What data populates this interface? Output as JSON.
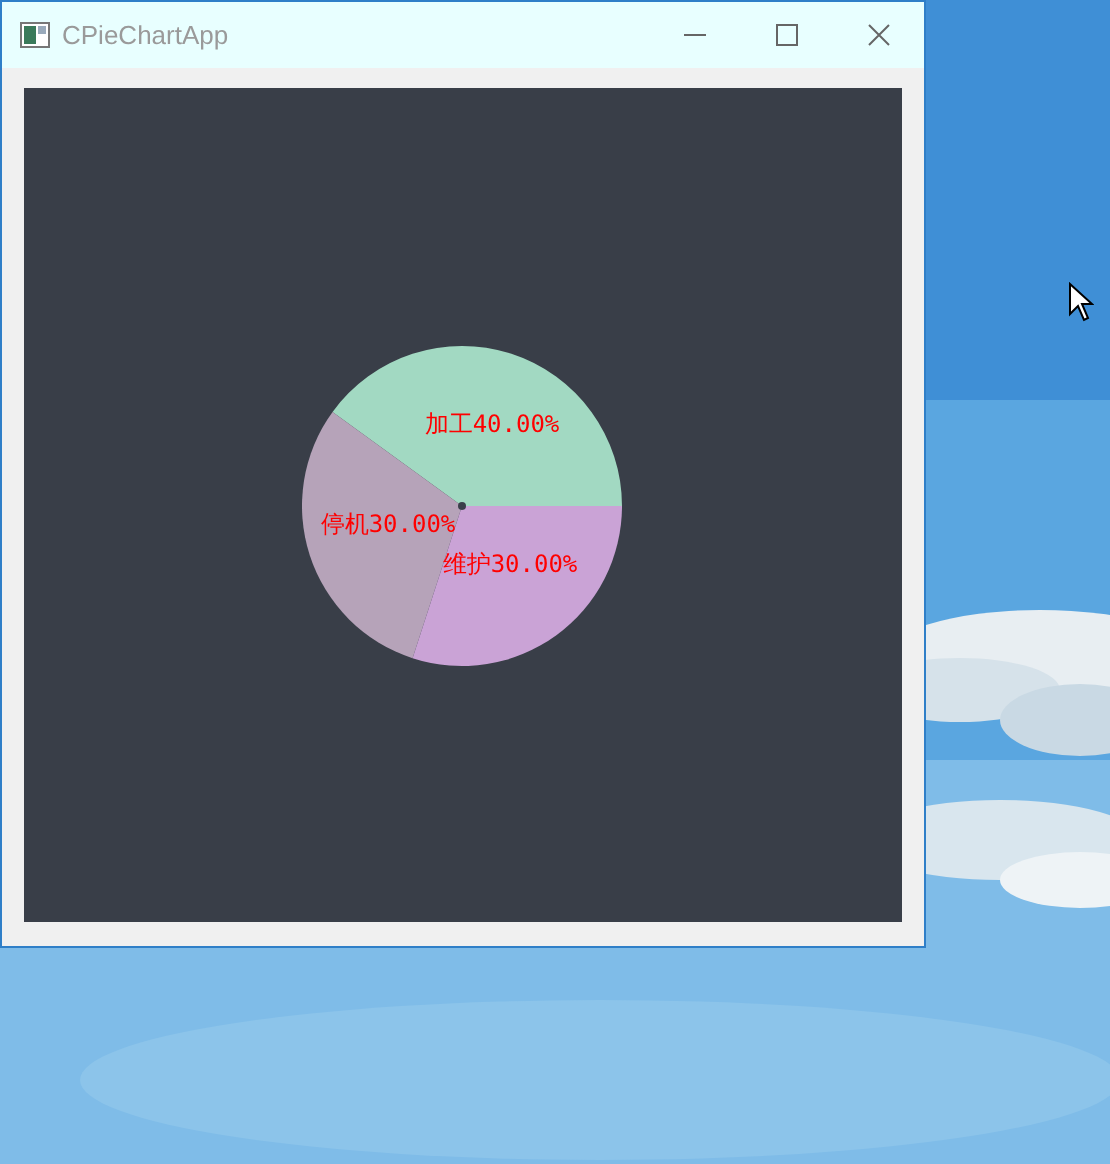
{
  "window": {
    "title": "CPieChartApp"
  },
  "chart_data": {
    "type": "pie",
    "categories": [
      "加工",
      "停机",
      "维护"
    ],
    "values": [
      40,
      30,
      30
    ],
    "colors": [
      "#a2d9c2",
      "#b6a3b9",
      "#caa3d6"
    ],
    "data_labels": true,
    "value_labels": [
      "40.00%",
      "30.00%",
      "30.00%"
    ]
  }
}
